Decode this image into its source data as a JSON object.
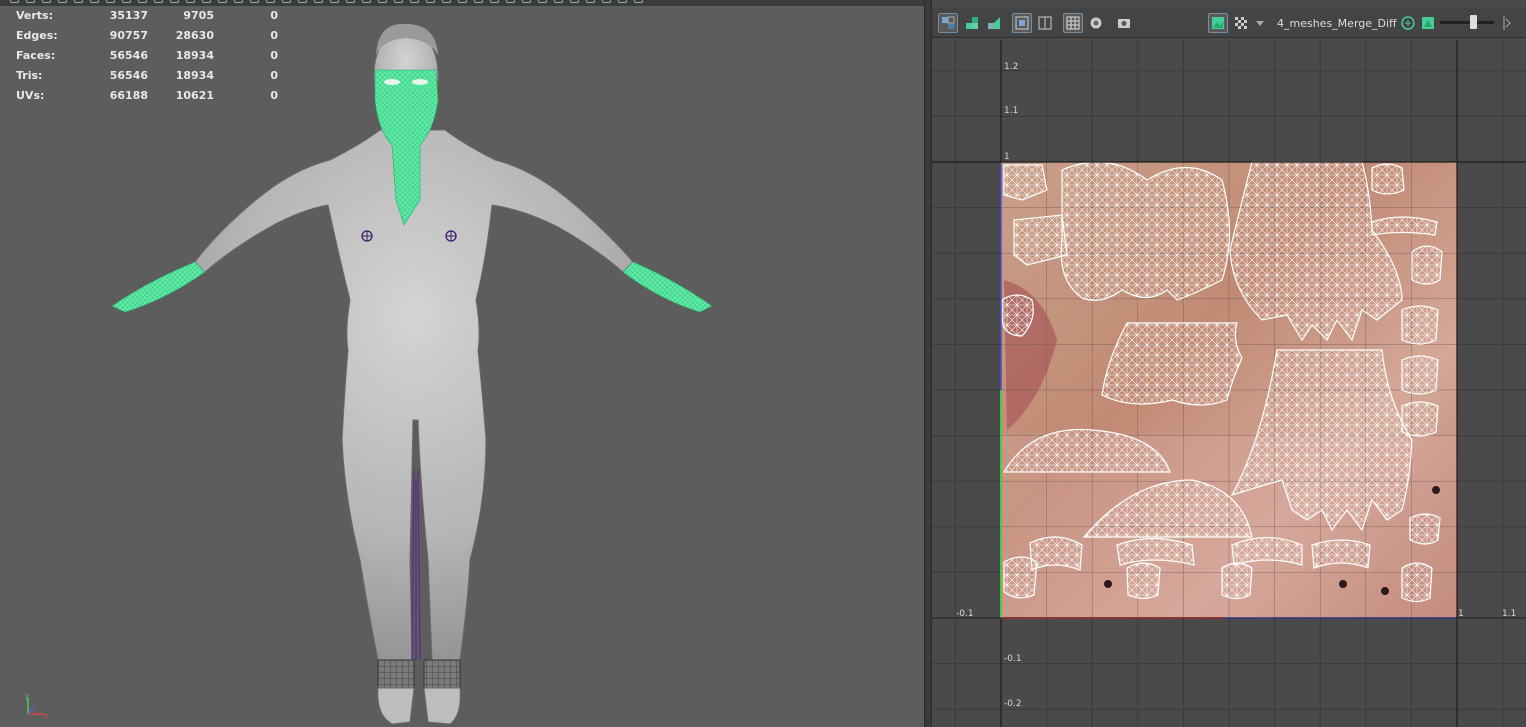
{
  "hud": {
    "rows": [
      {
        "label": "Verts:",
        "v1": "35137",
        "v2": "9705",
        "v3": "0"
      },
      {
        "label": "Edges:",
        "v1": "90757",
        "v2": "28630",
        "v3": "0"
      },
      {
        "label": "Faces:",
        "v1": "56546",
        "v2": "18934",
        "v3": "0"
      },
      {
        "label": "Tris:",
        "v1": "56546",
        "v2": "18934",
        "v3": "0"
      },
      {
        "label": "UVs:",
        "v1": "66188",
        "v2": "10621",
        "v3": "0"
      }
    ]
  },
  "viewport": {
    "axis_labels": {
      "y": "y",
      "x": "x"
    }
  },
  "uv_editor": {
    "texture_name": "4_meshes_Merge_Diff",
    "axis_labels": {
      "v_1_2": "1.2",
      "v_1_1": "1.1",
      "v_1": "1",
      "u_neg_0_1": "-0.1",
      "u_1": "1",
      "u_1_1": "1.1",
      "v_neg_0_1": "-0.1",
      "v_neg_0_2": "-0.2"
    },
    "icons": [
      "uv-select-icon",
      "uv-shell-icon",
      "uv-tool-icon",
      "isolate-icon",
      "display-icon",
      "grid-icon",
      "shaded-icon",
      "snapshot-icon",
      "texture-icon",
      "checker-icon",
      "dropdown-icon",
      "exposure-icon",
      "color-icon",
      "gamma-icon"
    ],
    "colors": {
      "wire": "#ffffff",
      "grid": "#3a3a3a",
      "u_axis": "#c44",
      "v_axis": "#4c4",
      "texture": "#c9a089"
    }
  }
}
